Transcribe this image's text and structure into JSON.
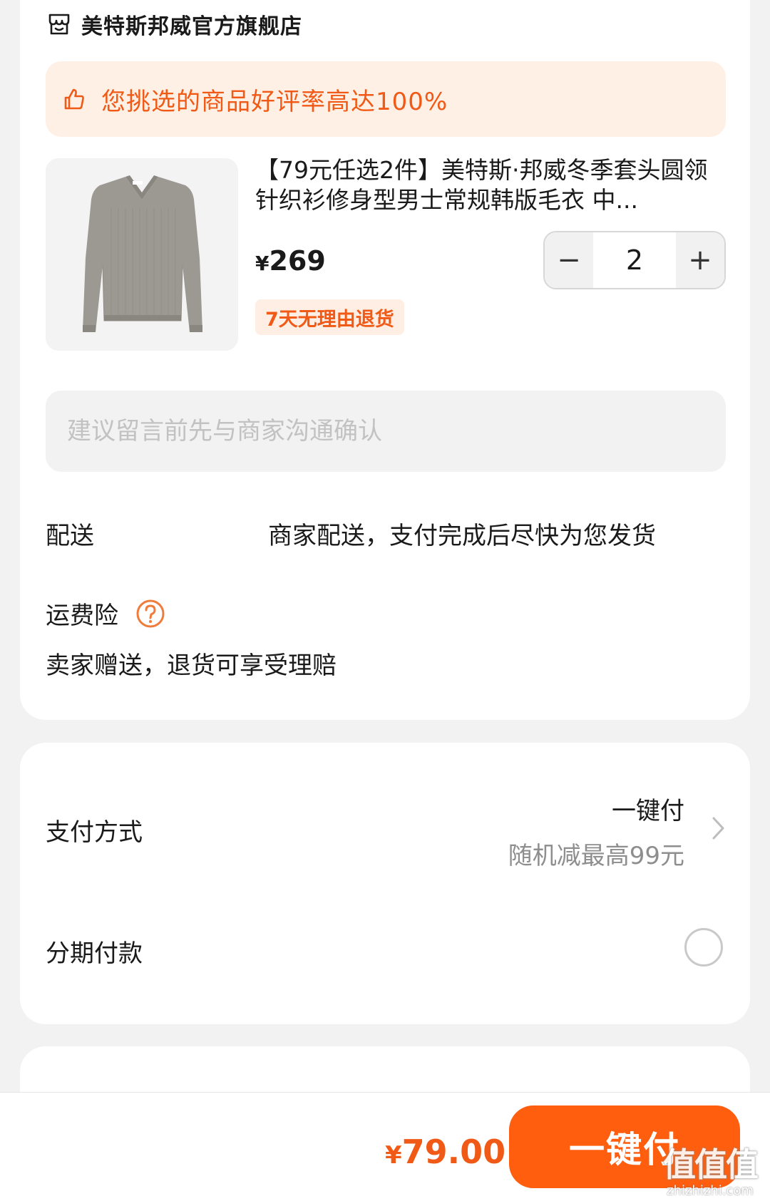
{
  "store": {
    "name": "美特斯邦威官方旗舰店",
    "icon": "store-icon"
  },
  "banner": {
    "icon": "thumb-up-icon",
    "text": "您挑选的商品好评率高达100%",
    "color": "#f05a16"
  },
  "product": {
    "title": "【79元任选2件】美特斯·邦威冬季套头圆领针织衫修身型男士常规韩版毛衣 中...",
    "price_symbol": "¥",
    "price_value": "269",
    "quantity": "2",
    "decrement_label": "−",
    "increment_label": "+",
    "badge": "7天无理由退货"
  },
  "note": {
    "placeholder": "建议留言前先与商家沟通确认",
    "value": ""
  },
  "delivery": {
    "label": "配送",
    "value": "商家配送，支付完成后尽快为您发货"
  },
  "insurance": {
    "label": "运费险",
    "icon": "help-icon",
    "value": "卖家赠送，退货可享受理赔"
  },
  "payment": {
    "label": "支付方式",
    "method": "一键付",
    "promo": "随机减最高99元",
    "icon": "chevron-right-icon"
  },
  "installment": {
    "label": "分期付款",
    "checked": false
  },
  "checkout": {
    "total_symbol": "¥",
    "total_value": "79.00",
    "button_label": "一键付",
    "accent_color": "#ff5e0e"
  },
  "watermark": {
    "chars": "值值值",
    "url": "zhizhizhi.com"
  }
}
